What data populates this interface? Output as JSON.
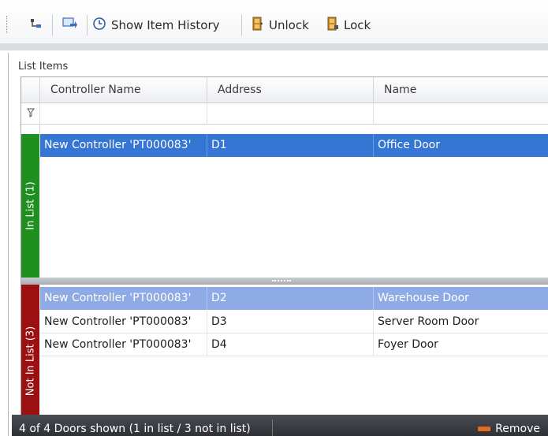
{
  "toolbar": {
    "show_history_label": "Show Item History",
    "unlock_label": "Unlock",
    "lock_label": "Lock"
  },
  "panel": {
    "title": "List Items"
  },
  "grid": {
    "columns": [
      "Controller Name",
      "Address",
      "Name"
    ]
  },
  "groups": {
    "in_list": {
      "label": "In List (1)",
      "color": "#1f8f1f",
      "rows": [
        {
          "controller": "New Controller 'PT000083'",
          "address": "D1",
          "name": "Office Door",
          "state": "selected"
        }
      ]
    },
    "not_in_list": {
      "label": "Not In List (3)",
      "color": "#9b1010",
      "rows": [
        {
          "controller": "New Controller 'PT000083'",
          "address": "D2",
          "name": "Warehouse Door",
          "state": "hover"
        },
        {
          "controller": "New Controller 'PT000083'",
          "address": "D3",
          "name": "Server Room Door",
          "state": "plain"
        },
        {
          "controller": "New Controller 'PT000083'",
          "address": "D4",
          "name": "Foyer Door",
          "state": "plain"
        }
      ]
    }
  },
  "status_bar": {
    "summary": "4 of 4 Doors shown (1 in list / 3 not in list)",
    "remove_label": "Remove"
  },
  "colors": {
    "selected_row": "#3575d3",
    "hover_row": "#8fabe5",
    "remove_icon": "#e56a1e"
  }
}
